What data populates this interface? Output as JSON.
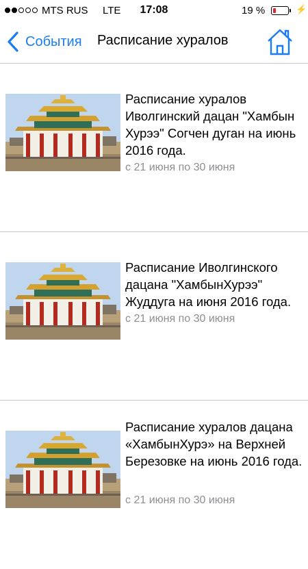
{
  "status_bar": {
    "signal_filled": 2,
    "signal_total": 5,
    "carrier": "MTS RUS",
    "network": "LTE",
    "time": "17:08",
    "battery": "19 %",
    "battery_level": 0.19,
    "battery_color": "#e5252b"
  },
  "nav": {
    "back_label": "События",
    "title": "Расписание хуралов",
    "accent_color": "#1a7cf4",
    "back_icon": "chevron-left-icon",
    "home_icon": "home-icon"
  },
  "items": [
    {
      "title": "Расписание хуралов Иволгинский дацан \"Хамбын Хурээ\" Согчен дуган на июнь 2016 года.",
      "date": "с 21 июня по 30 июня"
    },
    {
      "title": "Расписание Иволгинского дацана \"ХамбынХурээ\" Жуддуга на июня 2016 года.",
      "date": "с 21 июня по 30 июня"
    },
    {
      "title": "Расписание хуралов дацана «ХамбынХурэ» на Верхней Березовке на июнь 2016 года.",
      "date": "с 21 июня по 30 июня"
    }
  ]
}
